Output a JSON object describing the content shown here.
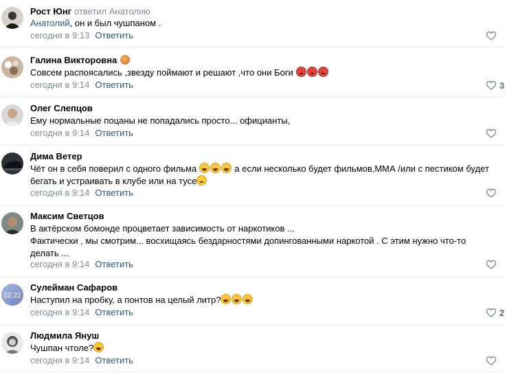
{
  "reply_label": "Ответить",
  "comments": [
    {
      "author": "Рост Юнг",
      "reply_note": "ответил Анатолию",
      "mention": "Анатолий",
      "text": ", он и был чушпаном .",
      "time": "сегодня в 9:13",
      "likes": ""
    },
    {
      "author": "Галина Викторовна",
      "text": "Совсем распоясались ,звезду поймают и решают ,что они Боги",
      "time": "сегодня в 9:14",
      "likes": "3"
    },
    {
      "author": "Олег Слепцов",
      "text": "Ему нормальные поцаны не попадались просто... официанты,",
      "time": "сегодня в 9:14",
      "likes": ""
    },
    {
      "author": "Дима Ветер",
      "text_a": "Чёт он в себя поверил с одного фильма",
      "text_b": " а если несколько будет фильмов,ММА /или с пестиком будет",
      "text_c": "бегать и устраивать в клубе или на тусе",
      "time": "сегодня в 9:14",
      "likes": ""
    },
    {
      "author": "Максим Светцов",
      "line1": "В актёрском бомонде процветает зависимость от наркотиков ...",
      "line2": "Фактически , мы смотрим... восхищаясь бездарностями допингованными наркотой . С этим нужно что-то",
      "line3": "делать ...",
      "time": "сегодня в 9:14",
      "likes": ""
    },
    {
      "author": "Сулейман Сафаров",
      "text": "Наступил на пробку, а понтов на целый литр?",
      "time": "сегодня в 9:14",
      "likes": "2",
      "avatar_text": "22:22"
    },
    {
      "author": "Людмила Януш",
      "text": "Чушпан чтоле?",
      "time": "сегодня в 9:14",
      "likes": ""
    }
  ]
}
